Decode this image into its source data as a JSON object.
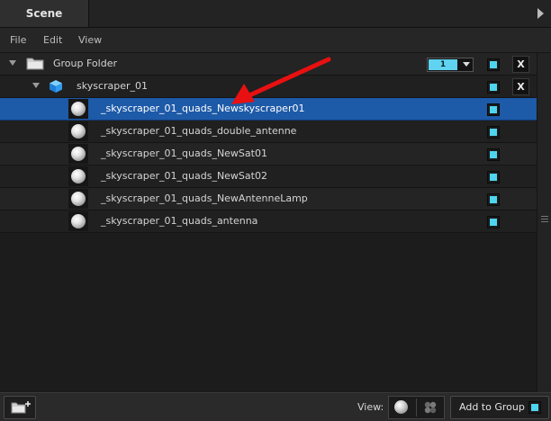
{
  "panel": {
    "tab_label": "Scene"
  },
  "menu": {
    "items": [
      "File",
      "Edit",
      "View"
    ]
  },
  "tree": {
    "group": {
      "label": "Group Folder",
      "layer_value": "1",
      "close_label": "X"
    },
    "object": {
      "label": "skyscraper_01",
      "close_label": "X"
    },
    "children": [
      {
        "label": "_skyscraper_01_quads_Newskyscraper01",
        "selected": true
      },
      {
        "label": "_skyscraper_01_quads_double_antenne",
        "selected": false
      },
      {
        "label": "_skyscraper_01_quads_NewSat01",
        "selected": false
      },
      {
        "label": "_skyscraper_01_quads_NewSat02",
        "selected": false
      },
      {
        "label": "_skyscraper_01_quads_NewAntenneLamp",
        "selected": false
      },
      {
        "label": "_skyscraper_01_quads_antenna",
        "selected": false
      }
    ]
  },
  "bottom": {
    "view_label": "View:",
    "add_group_label": "Add to Group"
  },
  "colors": {
    "selection": "#1d5aa8",
    "accent": "#4fd4ef",
    "annotation_arrow": "#e81010"
  },
  "icons": {
    "folder": "folder-icon",
    "cube": "cube-icon",
    "sphere": "sphere-icon",
    "new_folder": "new-folder-icon",
    "cluster": "cluster-icon"
  }
}
